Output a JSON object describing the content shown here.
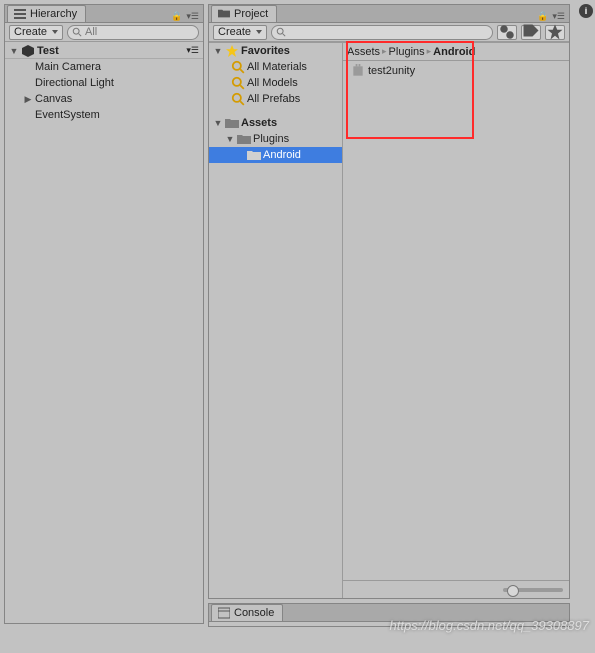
{
  "hierarchy": {
    "tab_label": "Hierarchy",
    "create_label": "Create",
    "search_placeholder": "All",
    "scene_name": "Test",
    "items": [
      "Main Camera",
      "Directional Light",
      "Canvas",
      "EventSystem"
    ]
  },
  "project": {
    "tab_label": "Project",
    "create_label": "Create",
    "favorites_label": "Favorites",
    "favorites": [
      "All Materials",
      "All Models",
      "All Prefabs"
    ],
    "assets_label": "Assets",
    "tree": {
      "plugins": "Plugins",
      "android": "Android"
    },
    "breadcrumb": [
      "Assets",
      "Plugins",
      "Android"
    ],
    "content_items": [
      "test2unity"
    ]
  },
  "console": {
    "tab_label": "Console"
  },
  "watermark": "https://blog.csdn.net/qq_39308897",
  "info_badge": "i"
}
